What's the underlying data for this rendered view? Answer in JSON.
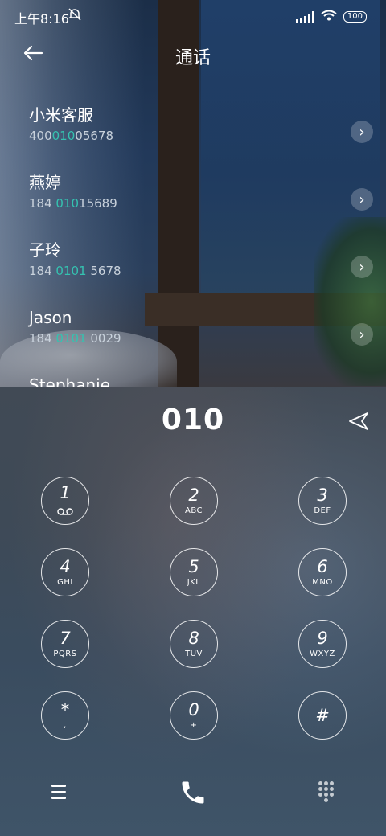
{
  "status_bar": {
    "time": "上午8:16",
    "battery": "100"
  },
  "header": {
    "title": "通话"
  },
  "contacts": [
    {
      "name": "小米客服",
      "number_pre": "400",
      "number_hl": "010",
      "number_post": "05678"
    },
    {
      "name": "燕婷",
      "number_pre": "184 ",
      "number_hl": "010",
      "number_post": "15689"
    },
    {
      "name": "子玲",
      "number_pre": "184 ",
      "number_hl": "0101",
      "number_post": " 5678"
    },
    {
      "name": "Jason",
      "number_pre": "184 ",
      "number_hl": "0101",
      "number_post": " 0029"
    },
    {
      "name": "Stephanie",
      "number_pre": "",
      "number_hl": "",
      "number_post": ""
    }
  ],
  "dialer": {
    "input": "010",
    "keys": [
      {
        "digit": "1",
        "letters": "⌓"
      },
      {
        "digit": "2",
        "letters": "ABC"
      },
      {
        "digit": "3",
        "letters": "DEF"
      },
      {
        "digit": "4",
        "letters": "GHI"
      },
      {
        "digit": "5",
        "letters": "JKL"
      },
      {
        "digit": "6",
        "letters": "MNO"
      },
      {
        "digit": "7",
        "letters": "PQRS"
      },
      {
        "digit": "8",
        "letters": "TUV"
      },
      {
        "digit": "9",
        "letters": "WXYZ"
      },
      {
        "digit": "*",
        "letters": ","
      },
      {
        "digit": "0",
        "letters": "+"
      },
      {
        "digit": "#",
        "letters": ""
      }
    ]
  },
  "colors": {
    "highlight": "#35c2b0"
  }
}
